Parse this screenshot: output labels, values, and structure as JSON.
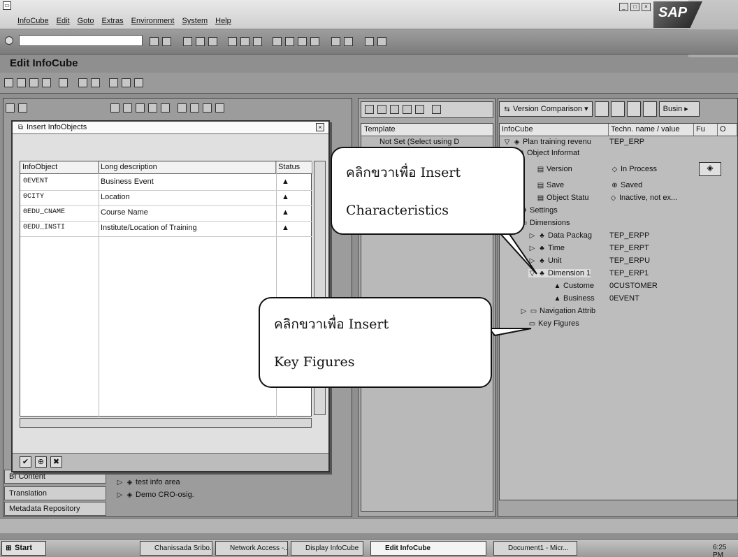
{
  "window": {
    "menu": [
      "InfoCube",
      "Edit",
      "Goto",
      "Extras",
      "Environment",
      "System",
      "Help"
    ],
    "brand": "SAP",
    "title": "Edit InfoCube"
  },
  "dialog": {
    "title": "Insert InfoObjects",
    "columns": [
      "InfoObject",
      "Long description",
      "Status"
    ],
    "rows": [
      {
        "infoobject": "0EVENT",
        "description": "Business Event"
      },
      {
        "infoobject": "0CITY",
        "description": "Location"
      },
      {
        "infoobject": "0EDU_CNAME",
        "description": "Course Name"
      },
      {
        "infoobject": "0EDU_INSTI",
        "description": "Institute/Location of Training"
      }
    ]
  },
  "left_tabs": [
    "BI Content",
    "Translation",
    "Metadata Repository"
  ],
  "left_tree": [
    "test info area",
    "Demo CRO-osig."
  ],
  "mid": {
    "header": "Template",
    "node": "Not Set (Select using D"
  },
  "right": {
    "tabs": [
      "Version Comparison",
      "Busin"
    ],
    "columns": [
      "InfoCube",
      "Techn. name / value",
      "Fu",
      "O"
    ],
    "tree": [
      {
        "label": "Plan training revenu",
        "value": "TEP_ERP"
      },
      {
        "label": "Object Informat",
        "value": ""
      },
      {
        "label": "Version",
        "value": "In Process"
      },
      {
        "label": "Save",
        "value": "Saved"
      },
      {
        "label": "Object Statu",
        "value": "Inactive, not ex..."
      },
      {
        "label": "Settings",
        "value": ""
      },
      {
        "label": "Dimensions",
        "value": ""
      },
      {
        "label": "Data Packag",
        "value": "TEP_ERPP"
      },
      {
        "label": "Time",
        "value": "TEP_ERPT"
      },
      {
        "label": "Unit",
        "value": "TEP_ERPU"
      },
      {
        "label": "Dimension 1",
        "value": "TEP_ERP1"
      },
      {
        "label": "Custome",
        "value": "0CUSTOMER"
      },
      {
        "label": "Business",
        "value": "0EVENT"
      },
      {
        "label": "Navigation Attrib",
        "value": ""
      },
      {
        "label": "Key Figures",
        "value": ""
      }
    ]
  },
  "callouts": {
    "characteristics": [
      "คลิกขวาเพื่อ Insert",
      "Characteristics"
    ],
    "keyfigures": [
      "คลิกขวาเพื่อ Insert",
      "Key Figures"
    ]
  },
  "taskbar": {
    "start": "Start",
    "items": [
      "Chanissada Sribo...",
      "Network Access -...",
      "Display InfoCube",
      "Edit InfoCube",
      "Document1 - Micr..."
    ],
    "clock": "6:25 PM"
  }
}
